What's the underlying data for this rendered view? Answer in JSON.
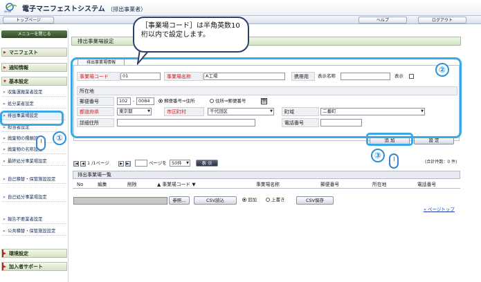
{
  "header": {
    "logo_text": "JWnet",
    "title": "電子マニフェストシステム",
    "subtitle": "（排出事業者）"
  },
  "topnav": {
    "top_page": "トップページ",
    "help": "ヘルプ",
    "logout": "ログアウト"
  },
  "sidebar": {
    "close_menu": "メニューを閉じる",
    "sections": {
      "manifest": "マニフェスト",
      "notice": "通知情報",
      "basic": "基本設定",
      "env": "環境設定",
      "support": "加入者サポート"
    },
    "items": [
      "収集運搬業者設定",
      "処分業者設定",
      "排出事業場設定",
      "担当者設定",
      "廃棄物の種類設定",
      "廃棄物の名称設定",
      "最終処分事業場設定",
      "自己積替・保管施設設定",
      "自己処分事業場設定",
      "報告不要業者設定",
      "公共積替・保管施設設定"
    ]
  },
  "page": {
    "title": "排出事業場設定"
  },
  "callout": {
    "text": "［事業場コード］は半角英数10桁以内で設定します。"
  },
  "badges": {
    "one": "①",
    "two": "②",
    "three": "③"
  },
  "form": {
    "tab": "排出事業場情報",
    "code_label": "事業場コード",
    "code_value": "01",
    "name_label": "事業場名称",
    "name_value": "A工場",
    "mobile_label": "携帯用",
    "display_name_label": "表示名称",
    "display_label": "表示",
    "location_label": "所在地",
    "zip_label": "郵便番号",
    "zip1": "102",
    "zip2": "0084",
    "radio_zip_to_addr": "郵便番号⇒住所",
    "radio_addr_to_zip": "住所⇒郵便番号",
    "pref_label": "都道府県",
    "pref_value": "東京都",
    "city_label": "市区町村",
    "city_value": "千代田区",
    "town_label": "町域",
    "town_value": "二番町",
    "detail_label": "詳細住所",
    "phone_label": "電話番号"
  },
  "buttons": {
    "add": "追 加",
    "set": "設 定"
  },
  "pager": {
    "text": "1 /1ページ",
    "page_input_suffix": "ページを",
    "per_page": "50件",
    "show": "表 示",
    "total": "(合計件数：0 件)"
  },
  "list": {
    "title": "排出事業場一覧",
    "columns": [
      "No",
      "編集",
      "削除",
      "▲ 事業場コード ▼",
      "事業場名称",
      "郵便番号",
      "所在地",
      "電話番号"
    ]
  },
  "csv": {
    "browse": "参照...",
    "read": "CSV読込",
    "add": "追加",
    "overwrite": "上書き",
    "save": "CSV保存"
  },
  "pagetop": "ページトップ"
}
